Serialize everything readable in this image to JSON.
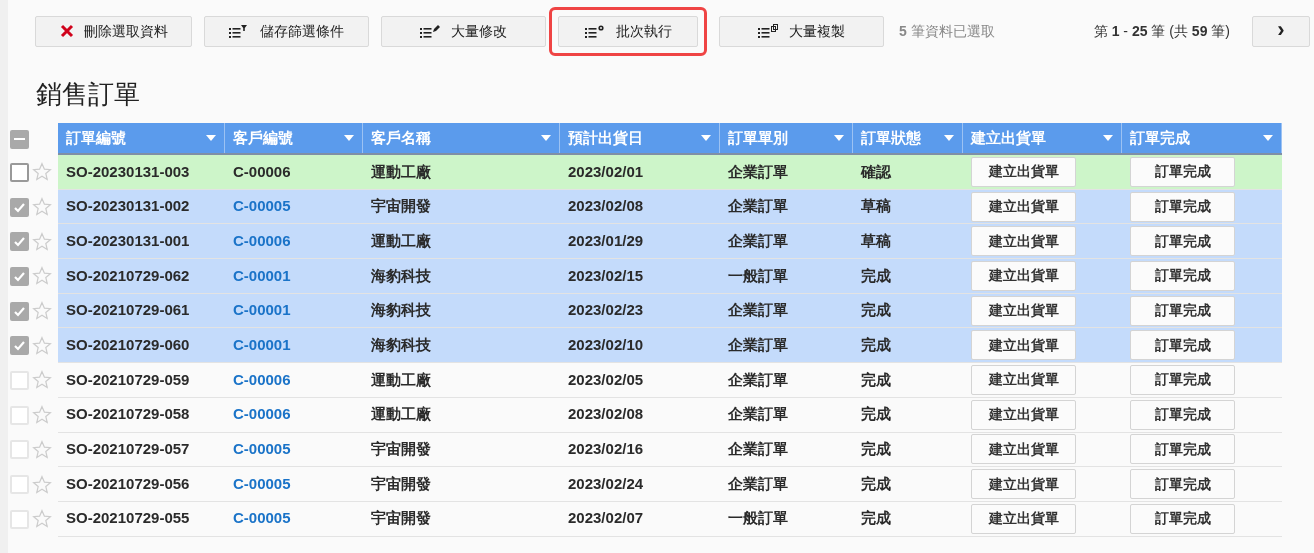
{
  "toolbar": {
    "buttons": [
      {
        "kind": "delete",
        "label": "刪除選取資料",
        "highlighted": false
      },
      {
        "kind": "filter",
        "label": "儲存篩選條件",
        "highlighted": false
      },
      {
        "kind": "edit",
        "label": "大量修改",
        "highlighted": false
      },
      {
        "kind": "gear",
        "label": "批次執行",
        "highlighted": true
      },
      {
        "kind": "copy",
        "label": "大量複製",
        "highlighted": false
      }
    ],
    "selection_count": "**5** 筆資料已選取",
    "pagination": "第 **1** - **25** 筆 (共 **59** 筆)",
    "next_button": "›"
  },
  "title": "銷售訂單",
  "table": {
    "select_all_checked": true,
    "select_all_partial": true,
    "columns": [
      "訂單編號",
      "客戶編號",
      "客戶名稱",
      "預計出貨日",
      "訂單單別",
      "訂單狀態",
      "建立出貨單",
      "訂單完成"
    ],
    "rows": [
      {
        "current": true,
        "checked": false,
        "starred": false,
        "order": "SO-20230131-003",
        "customer_id": "C-00006",
        "customer_link": false,
        "customer": "運動工廠",
        "ship_date": "2023/02/01",
        "type": "企業訂單",
        "status": "確認",
        "ship_button": "建立出貨單",
        "done_button": "訂單完成"
      },
      {
        "current": false,
        "checked": true,
        "starred": false,
        "order": "SO-20230131-002",
        "customer_id": "C-00005",
        "customer_link": true,
        "customer": "宇宙開發",
        "ship_date": "2023/02/08",
        "type": "企業訂單",
        "status": "草稿",
        "ship_button": "建立出貨單",
        "done_button": "訂單完成"
      },
      {
        "current": false,
        "checked": true,
        "starred": false,
        "order": "SO-20230131-001",
        "customer_id": "C-00006",
        "customer_link": true,
        "customer": "運動工廠",
        "ship_date": "2023/01/29",
        "type": "企業訂單",
        "status": "草稿",
        "ship_button": "建立出貨單",
        "done_button": "訂單完成"
      },
      {
        "current": false,
        "checked": true,
        "starred": false,
        "order": "SO-20210729-062",
        "customer_id": "C-00001",
        "customer_link": true,
        "customer": "海豹科技",
        "ship_date": "2023/02/15",
        "type": "一般訂單",
        "status": "完成",
        "ship_button": "建立出貨單",
        "done_button": "訂單完成"
      },
      {
        "current": false,
        "checked": true,
        "starred": false,
        "order": "SO-20210729-061",
        "customer_id": "C-00001",
        "customer_link": true,
        "customer": "海豹科技",
        "ship_date": "2023/02/23",
        "type": "企業訂單",
        "status": "完成",
        "ship_button": "建立出貨單",
        "done_button": "訂單完成"
      },
      {
        "current": false,
        "checked": true,
        "starred": false,
        "order": "SO-20210729-060",
        "customer_id": "C-00001",
        "customer_link": true,
        "customer": "海豹科技",
        "ship_date": "2023/02/10",
        "type": "企業訂單",
        "status": "完成",
        "ship_button": "建立出貨單",
        "done_button": "訂單完成"
      },
      {
        "current": false,
        "checked": false,
        "starred": false,
        "order": "SO-20210729-059",
        "customer_id": "C-00006",
        "customer_link": true,
        "customer": "運動工廠",
        "ship_date": "2023/02/05",
        "type": "企業訂單",
        "status": "完成",
        "ship_button": "建立出貨單",
        "done_button": "訂單完成"
      },
      {
        "current": false,
        "checked": false,
        "starred": false,
        "order": "SO-20210729-058",
        "customer_id": "C-00006",
        "customer_link": true,
        "customer": "運動工廠",
        "ship_date": "2023/02/08",
        "type": "企業訂單",
        "status": "完成",
        "ship_button": "建立出貨單",
        "done_button": "訂單完成"
      },
      {
        "current": false,
        "checked": false,
        "starred": false,
        "order": "SO-20210729-057",
        "customer_id": "C-00005",
        "customer_link": true,
        "customer": "宇宙開發",
        "ship_date": "2023/02/16",
        "type": "企業訂單",
        "status": "完成",
        "ship_button": "建立出貨單",
        "done_button": "訂單完成"
      },
      {
        "current": false,
        "checked": false,
        "starred": false,
        "order": "SO-20210729-056",
        "customer_id": "C-00005",
        "customer_link": true,
        "customer": "宇宙開發",
        "ship_date": "2023/02/24",
        "type": "企業訂單",
        "status": "完成",
        "ship_button": "建立出貨單",
        "done_button": "訂單完成"
      },
      {
        "current": false,
        "checked": false,
        "starred": false,
        "order": "SO-20210729-055",
        "customer_id": "C-00005",
        "customer_link": true,
        "customer": "宇宙開發",
        "ship_date": "2023/02/07",
        "type": "一般訂單",
        "status": "完成",
        "ship_button": "建立出貨單",
        "done_button": "訂單完成"
      }
    ]
  }
}
